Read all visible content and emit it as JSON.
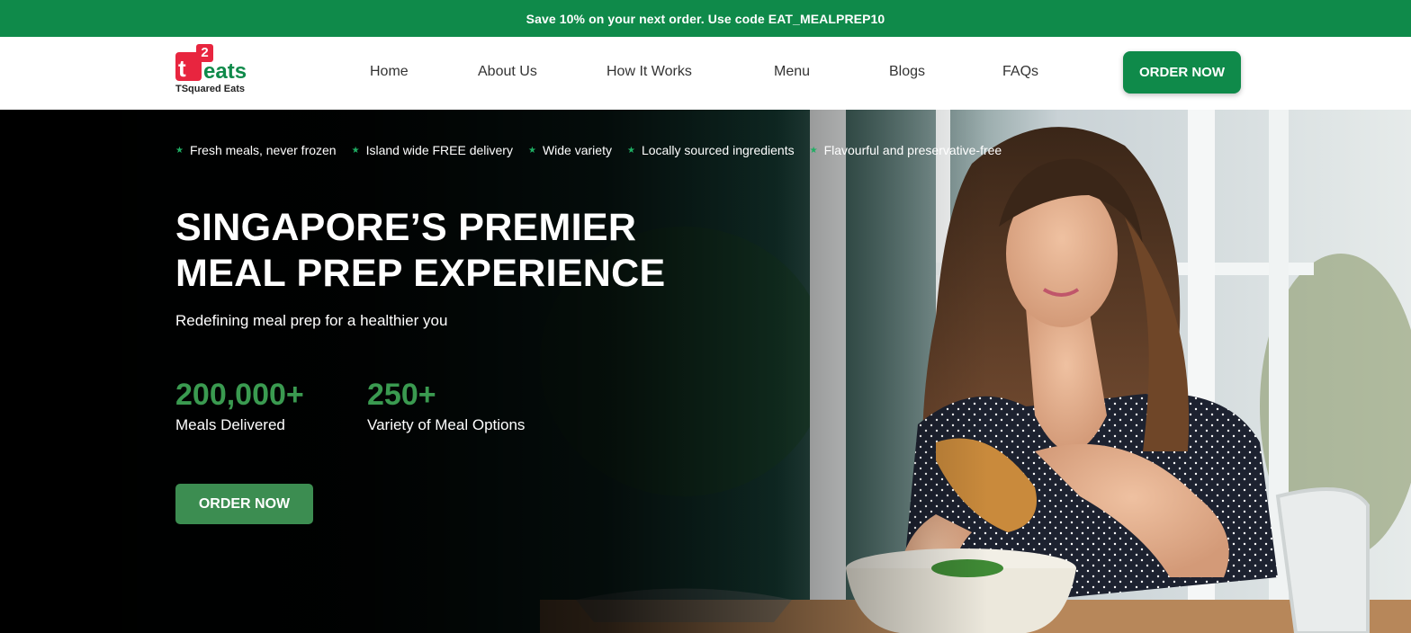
{
  "promo": {
    "text": "Save 10% on your next order. Use code EAT_MEALPREP10"
  },
  "header": {
    "logo": {
      "mark_letter": "t",
      "mark_superscript": "2",
      "wordmark": "eats",
      "subtitle": "TSquared Eats"
    },
    "nav": [
      "Home",
      "About Us",
      "How It Works",
      "Menu",
      "Blogs",
      "FAQs"
    ],
    "cta_label": "ORDER NOW"
  },
  "hero": {
    "features": [
      "Fresh meals, never frozen",
      "Island wide FREE delivery",
      "Wide variety",
      "Locally sourced ingredients",
      "Flavourful and preservative-free"
    ],
    "title_line1": "SINGAPORE’S PREMIER",
    "title_line2": "MEAL PREP EXPERIENCE",
    "subtitle": "Redefining meal prep for a healthier you",
    "stats": [
      {
        "value": "200,000+",
        "label": "Meals Delivered"
      },
      {
        "value": "250+",
        "label": "Variety of Meal Options"
      }
    ],
    "cta_label": "ORDER NOW",
    "background_image": "photo-woman-eating-meal-prep"
  },
  "colors": {
    "brand_green": "#0f8a4a",
    "stat_green": "#3a9a50",
    "logo_red": "#e8253f",
    "star_green": "#1fae63"
  },
  "icons": {
    "feature_bullet": "star-icon"
  }
}
